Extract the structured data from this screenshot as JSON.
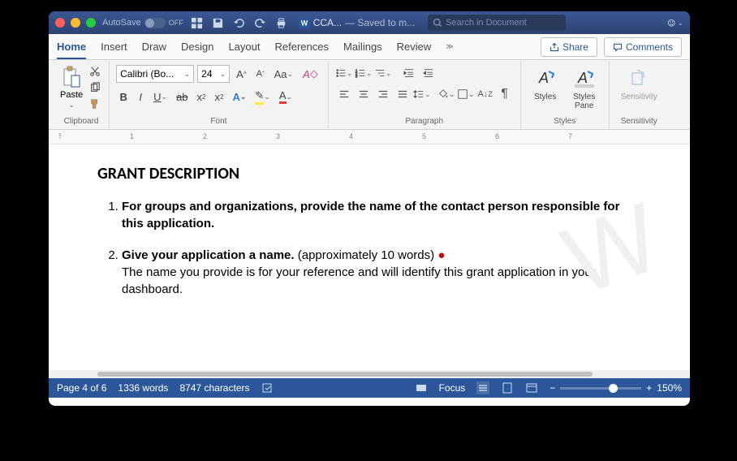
{
  "titlebar": {
    "autosave": "AutoSave",
    "off": "OFF",
    "doc": "CCA...",
    "saved": "— Saved to m...",
    "search": "Search in Document"
  },
  "tabs": {
    "home": "Home",
    "insert": "Insert",
    "draw": "Draw",
    "design": "Design",
    "layout": "Layout",
    "references": "References",
    "mailings": "Mailings",
    "review": "Review"
  },
  "actions": {
    "share": "Share",
    "comments": "Comments"
  },
  "ribbon": {
    "paste": "Paste",
    "font_name": "Calibri (Bo...",
    "font_size": "24",
    "clipboard": "Clipboard",
    "font": "Font",
    "paragraph": "Paragraph",
    "styles": "Styles",
    "styles_pane": "Styles\nPane",
    "sensitivity": "Sensitivity",
    "sensitivity_label": "Sensitivity",
    "styles_label": "Styles"
  },
  "ruler": {
    "m1": "1",
    "m2": "2",
    "m3": "3",
    "m4": "4",
    "m5": "5",
    "m6": "6",
    "m7": "7"
  },
  "document": {
    "heading": "GRANT DESCRIPTION",
    "q1": "For groups and organizations, provide the name of the contact person responsible for this application.",
    "q2a": "Give your application a name.",
    "q2b": " (approximately 10 words) ",
    "q2c": "The name you provide is for your reference and will identify this grant application in your dashboard."
  },
  "status": {
    "page": "Page 4 of 6",
    "words": "1336 words",
    "chars": "8747 characters",
    "focus": "Focus",
    "zoom": "150%"
  }
}
